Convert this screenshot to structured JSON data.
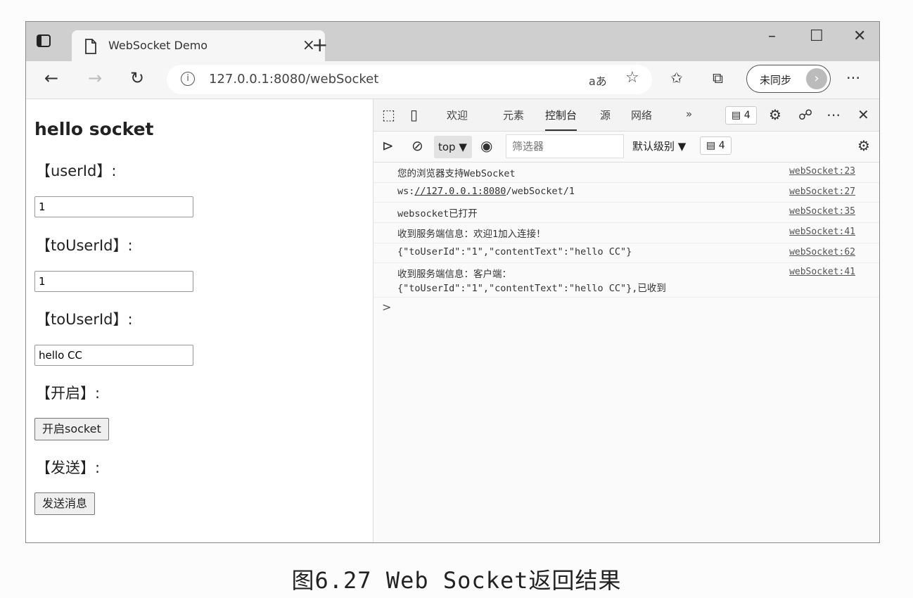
{
  "browser": {
    "tab_title": "WebSocket Demo",
    "url": "127.0.0.1:8080/webSocket",
    "read_aloud": "aあ",
    "sync_label": "未同步",
    "more": "···"
  },
  "page": {
    "heading": "hello socket",
    "userid_label": "【userId】:",
    "userid_value": "1",
    "touserid_label": "【toUserId】:",
    "touserid_value": "1",
    "content_label": "【toUserId】:",
    "content_value": "hello CC",
    "open_label": "【开启】:",
    "open_button": "开启socket",
    "send_label": "【发送】:",
    "send_button": "发送消息"
  },
  "devtools": {
    "tabs": [
      "欢迎",
      "元素",
      "控制台",
      "源",
      "网络"
    ],
    "active_tab": "控制台",
    "more_tabs": "»",
    "issues_count": "4",
    "context": "top ▼",
    "filter_placeholder": "筛选器",
    "level": "默认级别 ▼",
    "messages_count": "4",
    "prompt": ">"
  },
  "console": {
    "rows": [
      {
        "text": "您的浏览器支持WebSocket",
        "source": "webSocket:23"
      },
      {
        "text_prefix": "ws:",
        "text_link": "//127.0.0.1:8080",
        "text_suffix": "/webSocket/1",
        "source": "webSocket:27"
      },
      {
        "text": "websocket已打开",
        "source": "webSocket:35"
      },
      {
        "text": "收到服务端信息：欢迎1加入连接！",
        "source": "webSocket:41"
      },
      {
        "text": "{\"toUserId\":\"1\",\"contentText\":\"hello CC\"}",
        "source": "webSocket:62"
      },
      {
        "text": "收到服务端信息：客户端：",
        "text2": "{\"toUserId\":\"1\",\"contentText\":\"hello CC\"},已收到",
        "source": "webSocket:41"
      }
    ]
  },
  "caption": "图6.27  Web Socket返回结果"
}
